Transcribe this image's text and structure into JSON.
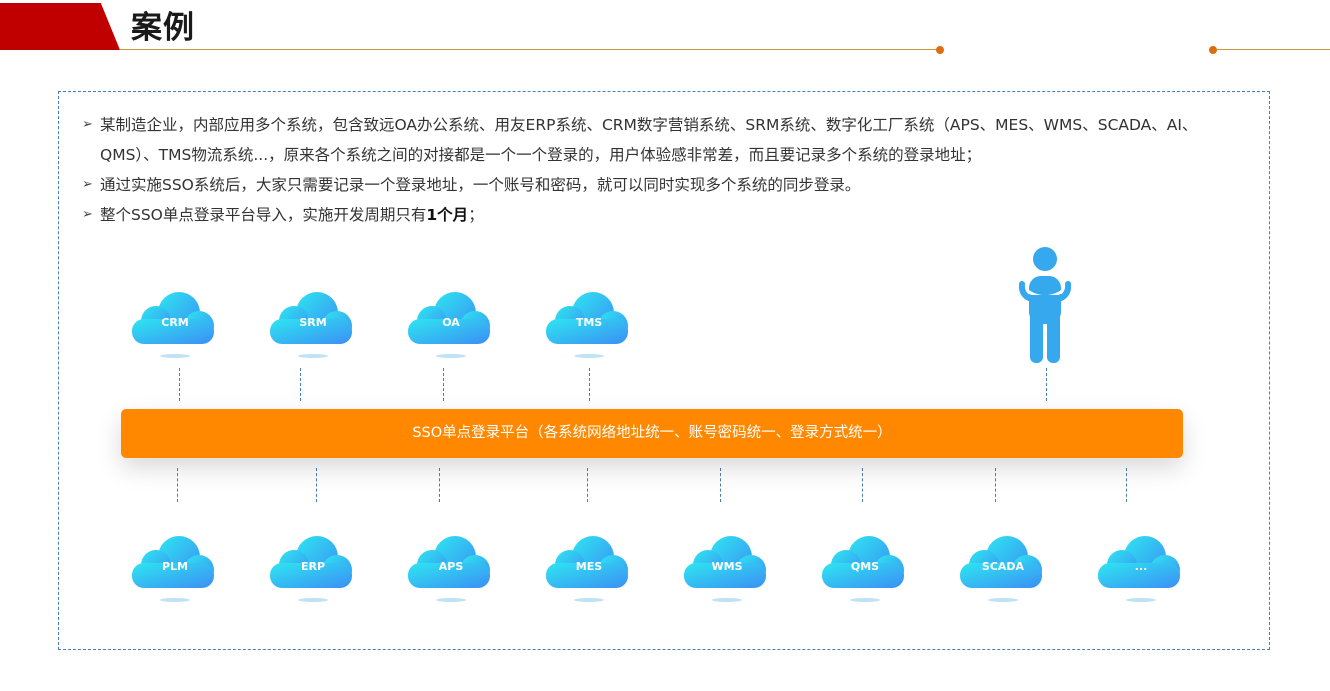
{
  "header": {
    "title": "案例"
  },
  "bullets": [
    "某制造企业，内部应用多个系统，包含致远OA办公系统、用友ERP系统、CRM数字营销系统、SRM系统、数字化工厂系统（APS、MES、WMS、SCADA、AI、QMS）、TMS物流系统...，原来各个系统之间的对接都是一个一个登录的，用户体验感非常差，而且要记录多个系统的登录地址；",
    "通过实施SSO系统后，大家只需要记录一个登录地址，一个账号和密码，就可以同时实现多个系统的同步登录。"
  ],
  "bullet3": {
    "prefix": "整个SSO单点登录平台导入，实施开发周期只有",
    "emphasis": "1个月",
    "suffix": "；"
  },
  "bullet_marker": "➢",
  "platform": {
    "label": "SSO单点登录平台（各系统网络地址统一、账号密码统一、登录方式统一）"
  },
  "top_systems": [
    "CRM",
    "SRM",
    "OA",
    "TMS"
  ],
  "bottom_systems": [
    "PLM",
    "ERP",
    "APS",
    "MES",
    "WMS",
    "QMS",
    "SCADA",
    "..."
  ],
  "icons": {
    "person": "person-arms-crossed-icon",
    "cloud": "cloud-icon"
  },
  "colors": {
    "accent_red": "#c00000",
    "platform_orange": "#ff8800",
    "cloud_start": "#2ee6f0",
    "cloud_end": "#3b8ff5",
    "frame_dash": "#4a7fb5"
  }
}
